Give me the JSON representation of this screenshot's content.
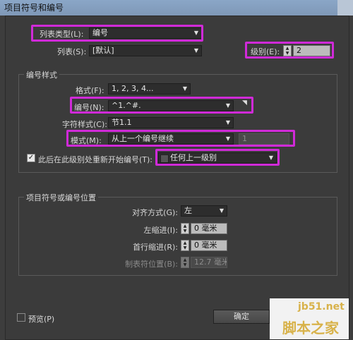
{
  "window": {
    "title": "项目符号和编号"
  },
  "list_type": {
    "label": "列表类型(L):",
    "value": "编号"
  },
  "list": {
    "label": "列表(S):",
    "value": "[默认]"
  },
  "level": {
    "label": "级别(E):",
    "value": "2"
  },
  "numbering_style": {
    "title": "编号样式",
    "format": {
      "label": "格式(F):",
      "value": "1, 2, 3, 4..."
    },
    "number": {
      "label": "编号(N):",
      "value": "^1.^#."
    },
    "char_style": {
      "label": "字符样式(C):",
      "value": "节1.1"
    },
    "mode": {
      "label": "模式(M):",
      "value": "从上一个编号继续",
      "start_value": "1"
    },
    "restart": {
      "label": "此后在此级别处重新开始编号(T):",
      "checked": true,
      "value": "任何上一级别"
    }
  },
  "position": {
    "title": "项目符号或编号位置",
    "alignment": {
      "label": "对齐方式(G):",
      "value": "左"
    },
    "left_indent": {
      "label": "左缩进(I):",
      "value": "0 毫米"
    },
    "first_line_indent": {
      "label": "首行缩进(R):",
      "value": "0 毫米"
    },
    "tab_position": {
      "label": "制表符位置(B):",
      "value": "12.7 毫米"
    }
  },
  "preview": {
    "label": "预览(P)",
    "checked": false
  },
  "buttons": {
    "ok": "确定"
  },
  "watermark": {
    "site": "jb51.net",
    "brand": "脚本之家"
  },
  "colors": {
    "highlight": "#d02ad8",
    "dialog_bg": "#3b3b3b",
    "titlebar": "#8aa6c7"
  }
}
